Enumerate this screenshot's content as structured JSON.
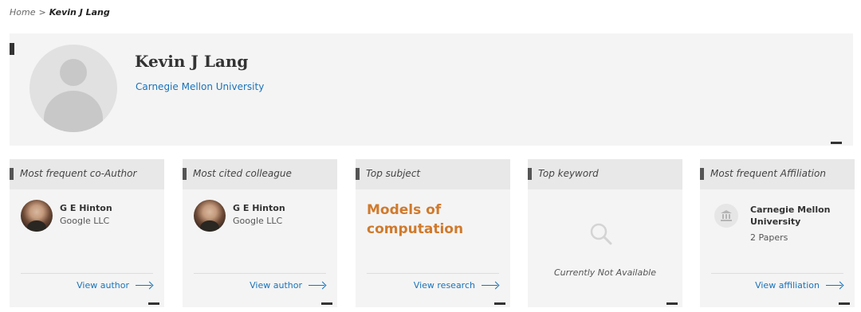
{
  "breadcrumb": {
    "home": "Home",
    "separator": ">",
    "current": "Kevin J Lang"
  },
  "profile": {
    "name": "Kevin J Lang",
    "affiliation": "Carnegie Mellon University"
  },
  "cards": {
    "coauthor": {
      "title": "Most frequent co-Author",
      "person_name": "G E Hinton",
      "person_org": "Google LLC",
      "link": "View author"
    },
    "colleague": {
      "title": "Most cited colleague",
      "person_name": "G E Hinton",
      "person_org": "Google LLC",
      "link": "View author"
    },
    "subject": {
      "title": "Top subject",
      "subject_line1": "Models of",
      "subject_line2": "computation",
      "link": "View research"
    },
    "keyword": {
      "title": "Top keyword",
      "status": "Currently Not Available"
    },
    "affiliation": {
      "title": "Most frequent Affiliation",
      "name_line1": "Carnegie Mellon",
      "name_line2": "University",
      "papers": "2 Papers",
      "link": "View affiliation"
    }
  },
  "colors": {
    "link": "#1a73b8",
    "subject": "#d07a2c",
    "panel": "#f4f4f4"
  },
  "icons": {
    "person": "person-silhouette-icon",
    "search": "search-icon",
    "institution": "institution-icon",
    "arrow": "arrow-right-icon"
  }
}
